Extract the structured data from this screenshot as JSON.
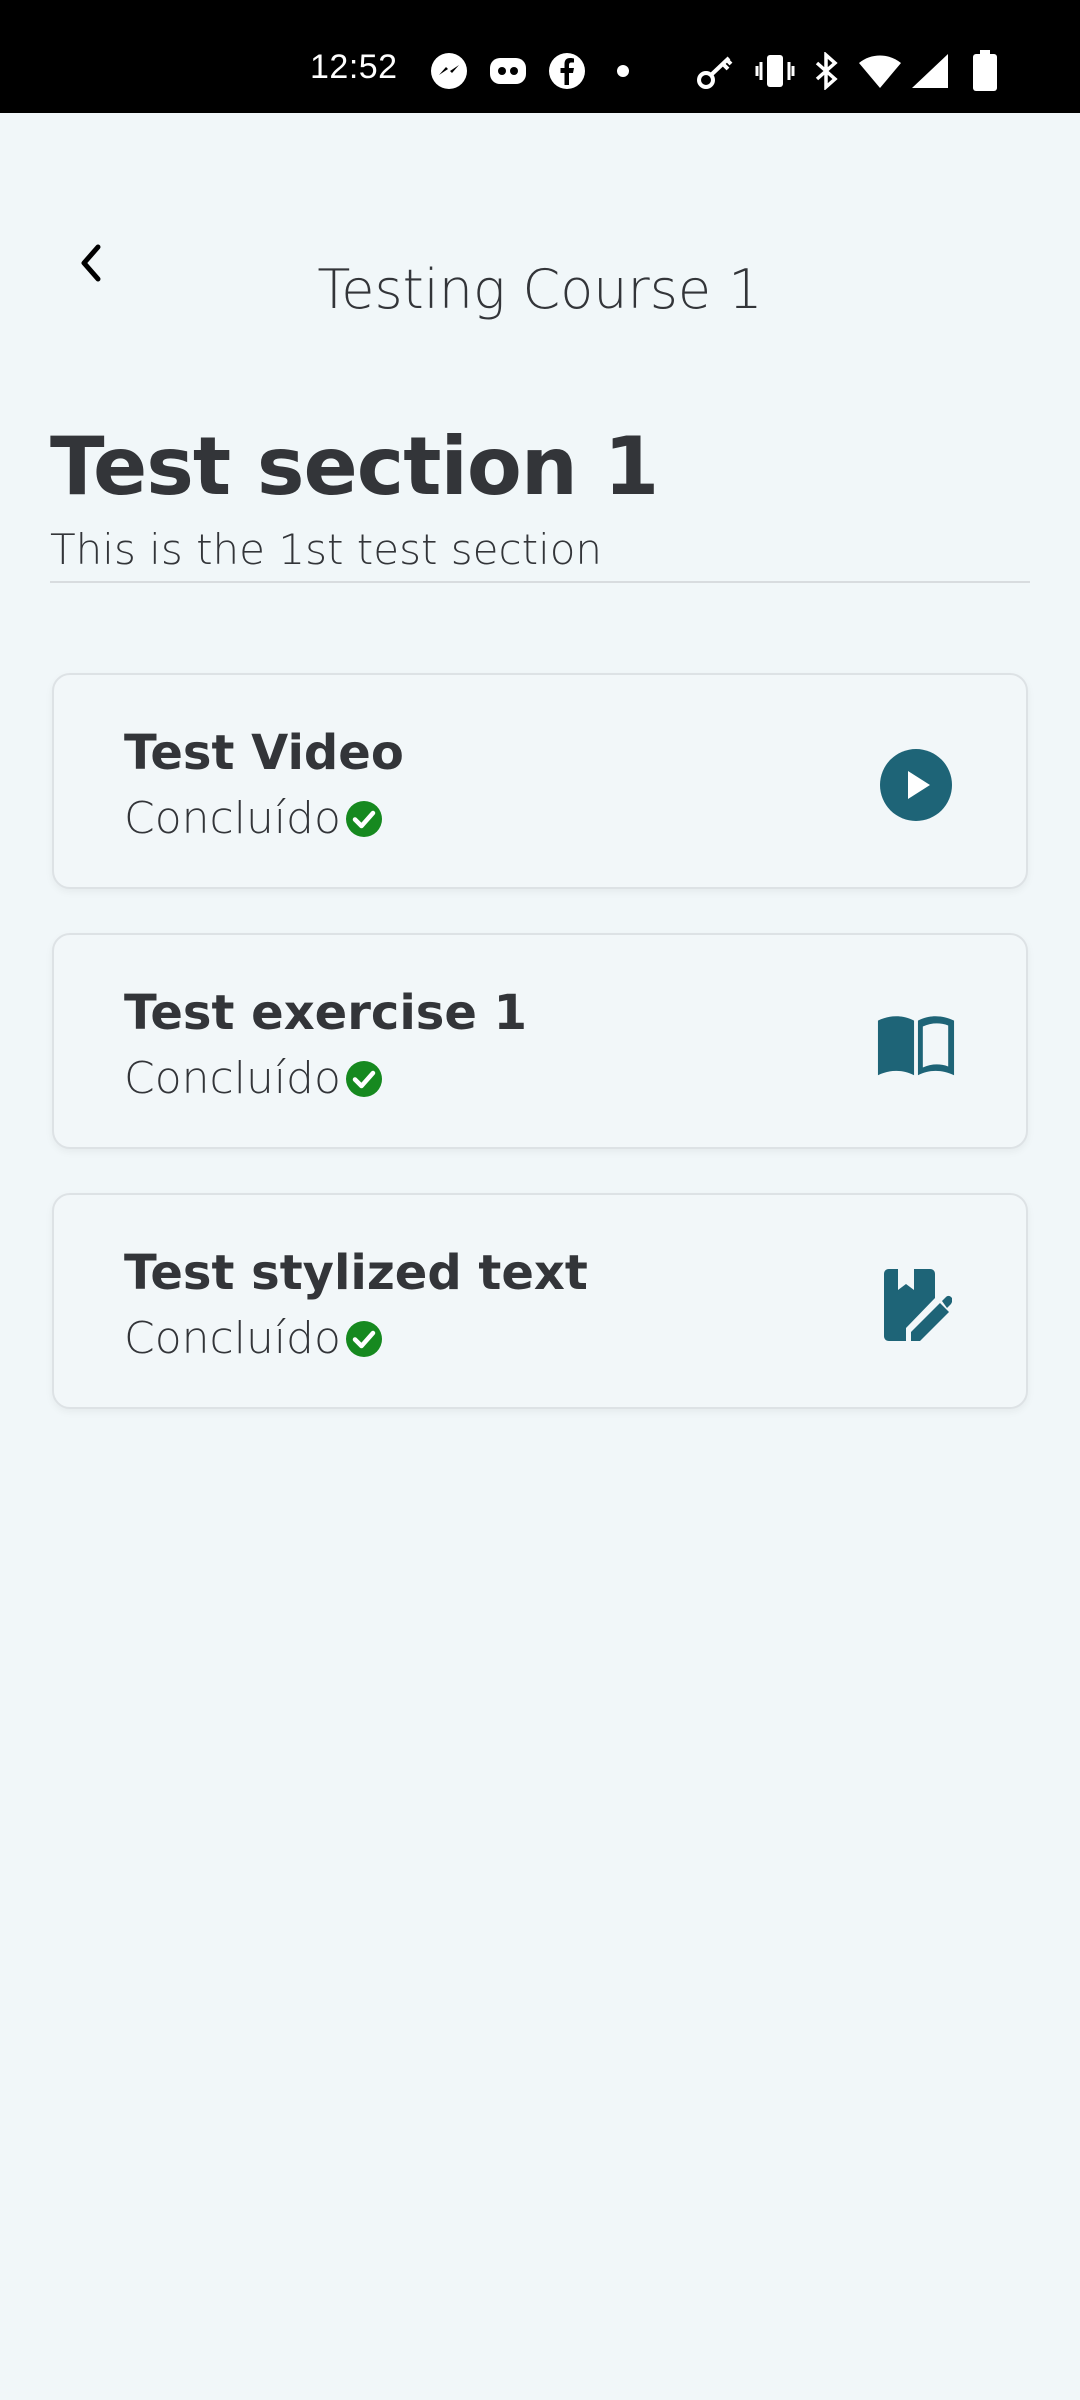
{
  "status_bar": {
    "time": "12:52",
    "icons": [
      "messenger-icon",
      "discord-icon",
      "facebook-icon",
      "dot-icon",
      "key-icon",
      "vibrate-icon",
      "bluetooth-icon",
      "wifi-icon",
      "signal-icon",
      "battery-icon"
    ]
  },
  "header": {
    "title": "Testing Course 1",
    "back_icon": "chevron-left-icon"
  },
  "section": {
    "title": "Test section 1",
    "description": "This is the 1st test section"
  },
  "items": [
    {
      "title": "Test Video",
      "status": "Concluído",
      "icon": "play-circle-icon"
    },
    {
      "title": "Test exercise 1",
      "status": "Concluído",
      "icon": "book-open-icon"
    },
    {
      "title": "Test stylized text",
      "status": "Concluído",
      "icon": "edit-note-icon"
    }
  ],
  "colors": {
    "accent": "#1e6477",
    "success": "#16891f",
    "background": "#f1f7f9",
    "text": "#333539"
  }
}
